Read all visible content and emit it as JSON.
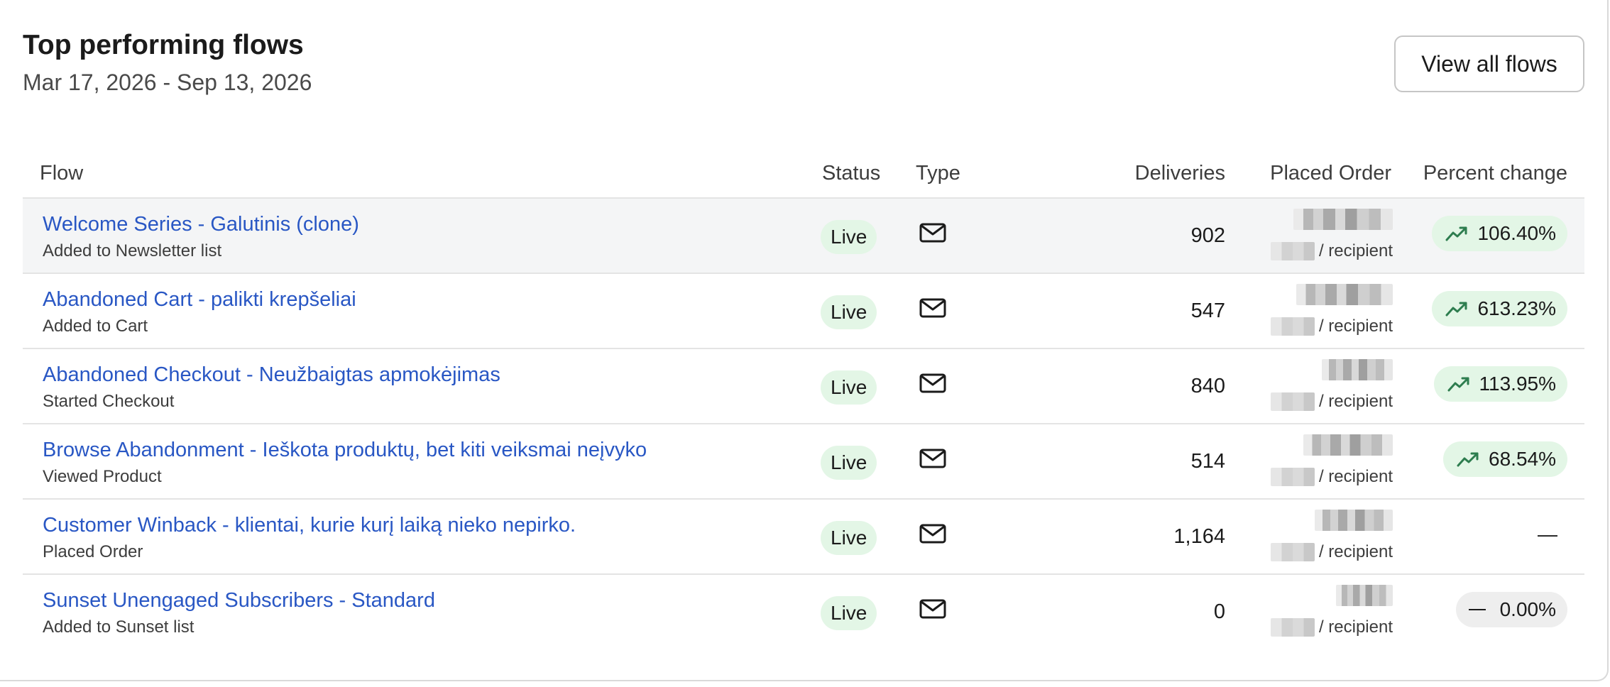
{
  "header": {
    "title": "Top performing flows",
    "date_range": "Mar 17, 2026 - Sep 13, 2026",
    "view_all_label": "View all flows"
  },
  "columns": {
    "flow": "Flow",
    "status": "Status",
    "type": "Type",
    "deliveries": "Deliveries",
    "placed_order": "Placed Order",
    "percent_change": "Percent change"
  },
  "icons": {
    "type": "envelope-icon",
    "trend_up": "trending-up-icon",
    "flat": "dash-icon"
  },
  "colors": {
    "link": "#2957c4",
    "live_pill": "#e3f6e6",
    "trend_up": "#2e7d4f"
  },
  "rows": [
    {
      "name": "Welcome Series - Galutinis (clone)",
      "trigger": "Added to Newsletter list",
      "status": "Live",
      "deliveries": "902",
      "per_recipient": "/ recipient",
      "percent_change": "106.40%",
      "trend": "up"
    },
    {
      "name": "Abandoned Cart - palikti krepšeliai",
      "trigger": "Added to Cart",
      "status": "Live",
      "deliveries": "547",
      "per_recipient": "/ recipient",
      "percent_change": "613.23%",
      "trend": "up"
    },
    {
      "name": "Abandoned Checkout - Neužbaigtas apmokėjimas",
      "trigger": "Started Checkout",
      "status": "Live",
      "deliveries": "840",
      "per_recipient": "/ recipient",
      "percent_change": "113.95%",
      "trend": "up"
    },
    {
      "name": "Browse Abandonment - Ieškota produktų, bet kiti veiksmai neįvyko",
      "trigger": "Viewed Product",
      "status": "Live",
      "deliveries": "514",
      "per_recipient": "/ recipient",
      "percent_change": "68.54%",
      "trend": "up"
    },
    {
      "name": "Customer Winback - klientai, kurie kurį laiką nieko nepirko.",
      "trigger": "Placed Order",
      "status": "Live",
      "deliveries": "1,164",
      "per_recipient": "/ recipient",
      "percent_change": "—",
      "trend": "none"
    },
    {
      "name": "Sunset Unengaged Subscribers - Standard",
      "trigger": "Added to Sunset list",
      "status": "Live",
      "deliveries": "0",
      "per_recipient": "/ recipient",
      "percent_change": "0.00%",
      "trend": "flat"
    }
  ]
}
